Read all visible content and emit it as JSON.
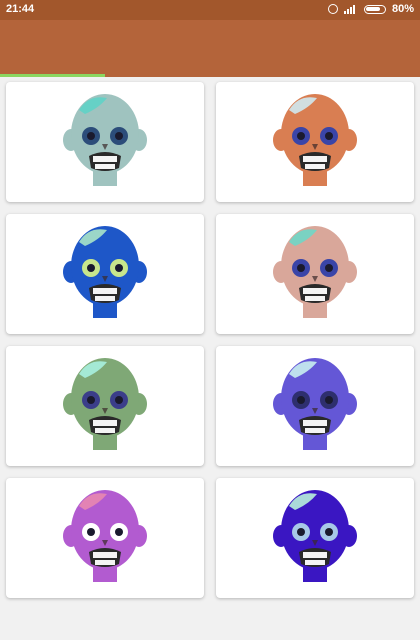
{
  "status_bar": {
    "time": "21:44",
    "battery": "80%"
  },
  "grid": {
    "items": [
      {
        "name": "zombie-1",
        "skin": "#9fc3bf",
        "brain": "#5fd3c6",
        "eye": "#2c4d7a"
      },
      {
        "name": "zombie-2",
        "skin": "#d97e52",
        "brain": "#cfe9ef",
        "eye": "#3a45a8"
      },
      {
        "name": "zombie-3",
        "skin": "#1e57c8",
        "brain": "#a9e4c8",
        "eye": "#c8e68c"
      },
      {
        "name": "zombie-4",
        "skin": "#d9a79a",
        "brain": "#6fd7c6",
        "eye": "#3a45a8"
      },
      {
        "name": "zombie-5",
        "skin": "#7fa876",
        "brain": "#a8f0e0",
        "eye": "#3b3e8a"
      },
      {
        "name": "zombie-6",
        "skin": "#6457d6",
        "brain": "#c8f0ef",
        "eye": "#2e2f6e"
      },
      {
        "name": "zombie-7",
        "skin": "#b25bd0",
        "brain": "#e887b0",
        "eye": "#ffffff"
      },
      {
        "name": "zombie-8",
        "skin": "#3a16c2",
        "brain": "#b8f0dc",
        "eye": "#a7c8e8"
      }
    ]
  },
  "loading_progress": 0.25
}
